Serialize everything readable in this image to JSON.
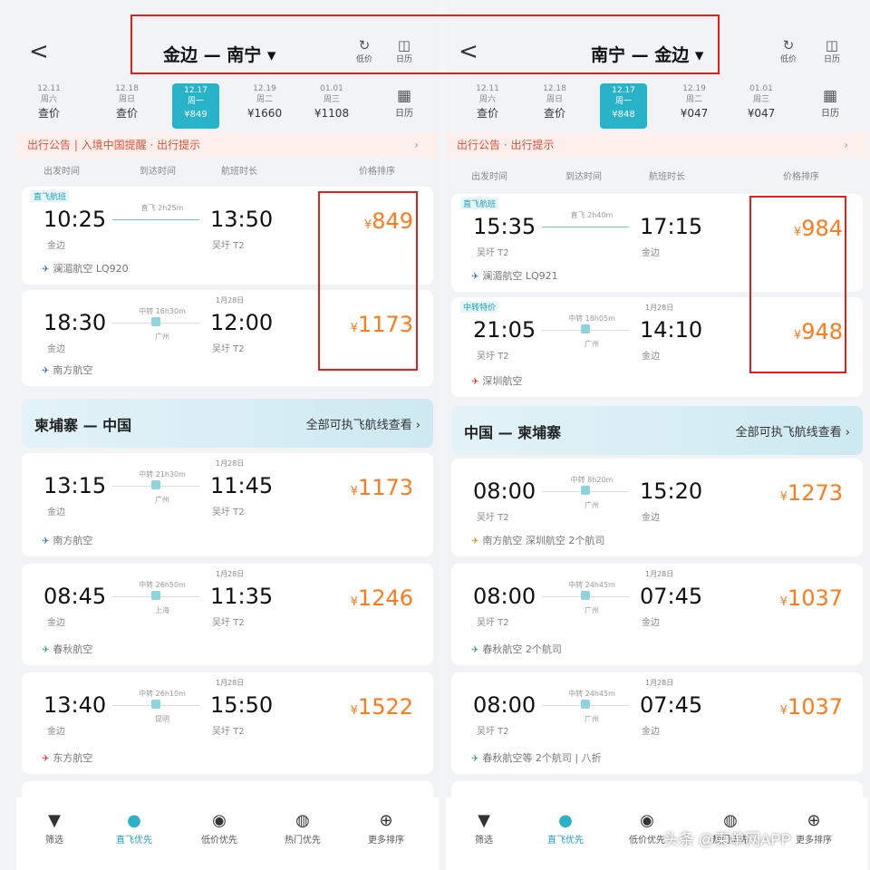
{
  "left": {
    "route": "金边 — 南宁 ▾",
    "back": "<",
    "icons": [
      {
        "sym": "↻",
        "label": "低价"
      },
      {
        "sym": "◫",
        "label": "日历"
      }
    ],
    "dates": [
      {
        "d1": "12.11",
        "d2": "周六",
        "p": "查价"
      },
      {
        "d1": "12.18",
        "d2": "周日",
        "p": "查价"
      },
      {
        "d1": "12.17",
        "d2": "周一",
        "p": "¥849",
        "selected": true
      },
      {
        "d1": "12.19",
        "d2": "周二",
        "p": "¥1660"
      },
      {
        "d1": "01.01",
        "d2": "周三",
        "p": "¥1108"
      }
    ],
    "calendar": "日历",
    "notice": "出行公告 | 入境中国提醒 · 出行提示",
    "columns": [
      "出发时间",
      "到达时间",
      "航班时长",
      "价格排序"
    ],
    "flights_top": [
      {
        "tag": "直飞航班",
        "dep": "10:25",
        "arr": "13:50",
        "dep_ap": "金边",
        "arr_ap": "吴圩 T2",
        "mid": "直飞 2h25m",
        "price": "849",
        "airline": "澜湄航空 LQ920"
      },
      {
        "tag": "",
        "dep": "18:30",
        "arr": "12:00",
        "dep_ap": "金边",
        "arr_ap": "吴圩 T2",
        "mid": "中转 16h30m",
        "stop": "广州",
        "note": "1月28日",
        "price": "1173",
        "airline": "南方航空"
      }
    ],
    "section": {
      "route": "柬埔寨 — 中国",
      "link": "全部可执飞航线查看 ›"
    },
    "flights_bottom": [
      {
        "dep": "13:15",
        "arr": "11:45",
        "dep_ap": "金边",
        "arr_ap": "吴圩 T2",
        "mid": "中转 21h30m",
        "stop": "广州",
        "note": "1月28日",
        "price": "1173",
        "airline": "南方航空"
      },
      {
        "dep": "08:45",
        "arr": "11:35",
        "dep_ap": "金边",
        "arr_ap": "吴圩 T2",
        "mid": "中转 26h50m",
        "stop": "上海",
        "note": "1月28日",
        "price": "1246",
        "airline": "春秋航空"
      },
      {
        "dep": "13:40",
        "arr": "15:50",
        "dep_ap": "金边",
        "arr_ap": "吴圩 T2",
        "mid": "中转 26h10m",
        "stop": "昆明",
        "note": "1月28日",
        "price": "1522",
        "airline": "东方航空"
      }
    ],
    "nav": [
      "筛选",
      "直飞优先",
      "低价优先",
      "热门优先",
      "更多排序"
    ]
  },
  "right": {
    "route": "南宁 — 金边 ▾",
    "back": "<",
    "icons": [
      {
        "sym": "↻",
        "label": "低价"
      },
      {
        "sym": "◫",
        "label": "日历"
      }
    ],
    "dates": [
      {
        "d1": "12.11",
        "d2": "周六",
        "p": "查价"
      },
      {
        "d1": "12.18",
        "d2": "周日",
        "p": "查价"
      },
      {
        "d1": "12.17",
        "d2": "周一",
        "p": "¥848",
        "selected": true
      },
      {
        "d1": "12.19",
        "d2": "周二",
        "p": "¥047"
      },
      {
        "d1": "01.01",
        "d2": "周三",
        "p": "¥047"
      }
    ],
    "calendar": "日历",
    "notice": "出行公告 · 出行提示",
    "columns": [
      "出发时间",
      "到达时间",
      "航班时长",
      "价格排序"
    ],
    "flights_top": [
      {
        "tag": "直飞航班",
        "dep": "15:35",
        "arr": "17:15",
        "dep_ap": "吴圩 T2",
        "arr_ap": "金边",
        "mid": "直飞 2h40m",
        "price": "984",
        "airline": "澜湄航空 LQ921"
      },
      {
        "tag": "中转特价",
        "dep": "21:05",
        "arr": "14:10",
        "dep_ap": "吴圩 T2",
        "arr_ap": "金边",
        "mid": "中转 18h05m",
        "stop": "广州",
        "note": "1月28日",
        "price": "948",
        "airline": "深圳航空"
      }
    ],
    "section": {
      "route": "中国 — 柬埔寨",
      "link": "全部可执飞航线查看 ›"
    },
    "flights_bottom": [
      {
        "dep": "08:00",
        "arr": "15:20",
        "dep_ap": "吴圩 T2",
        "arr_ap": "金边",
        "mid": "中转 8h20m",
        "stop": "广州",
        "note": "",
        "price": "1273",
        "airline": "南方航空 深圳航空 2个航司"
      },
      {
        "dep": "08:00",
        "arr": "07:45",
        "dep_ap": "吴圩 T2",
        "arr_ap": "金边",
        "mid": "中转 24h45m",
        "stop": "广州",
        "note": "1月28日",
        "price": "1037",
        "airline": "春秋航空 2个航司"
      },
      {
        "dep": "08:00",
        "arr": "07:45",
        "dep_ap": "吴圩 T2",
        "arr_ap": "金边",
        "mid": "中转 24h45m",
        "stop": "广州",
        "note": "1月28日",
        "price": "1037",
        "airline": "春秋航空等 2个航司 | 八折"
      }
    ],
    "nav": [
      "筛选",
      "直飞优先",
      "低价优先",
      "热门优先",
      "更多排序"
    ]
  },
  "watermark": "头条 @柬单网APP",
  "colors": {
    "accent": "#29b3c8",
    "price": "#ff7a1a",
    "highlight": "#e0211b",
    "notice": "#e0503a"
  }
}
